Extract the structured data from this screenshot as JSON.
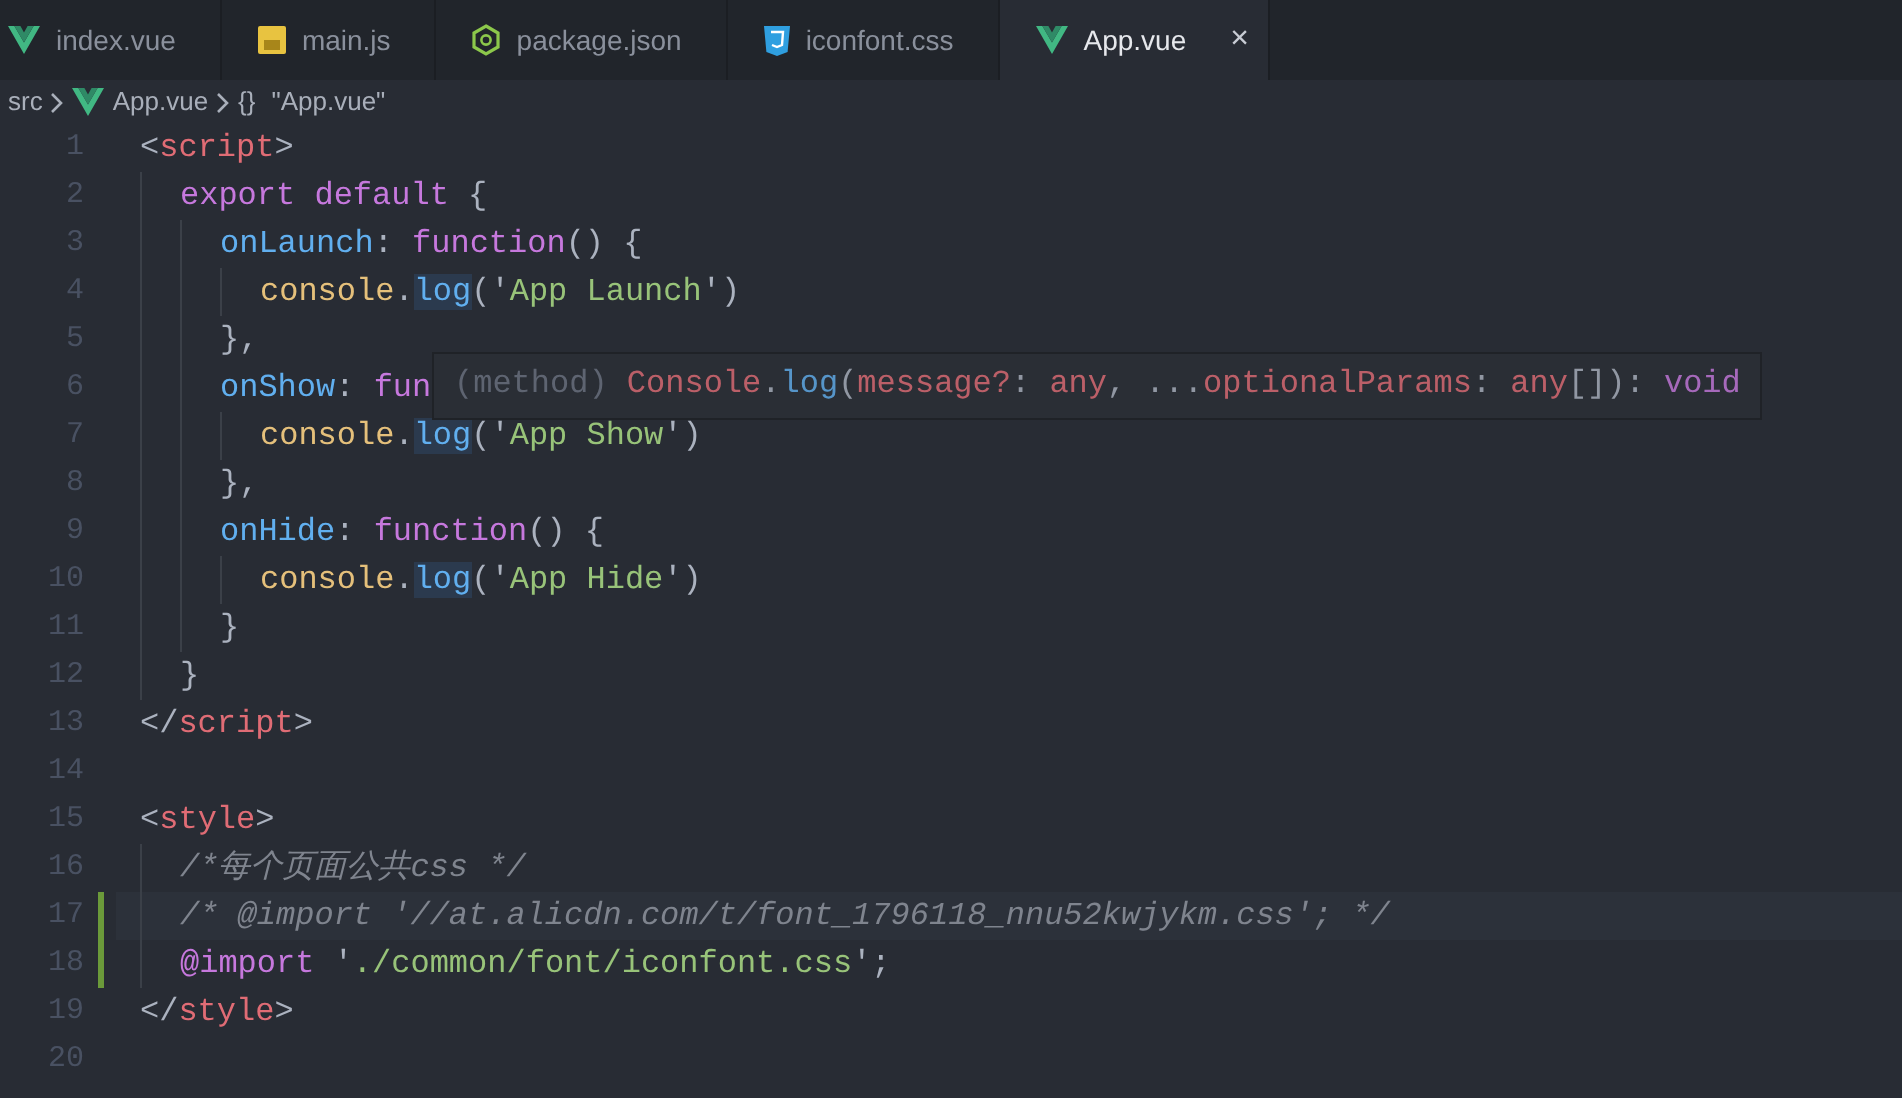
{
  "tabs": [
    {
      "label": "index.vue",
      "kind": "vue",
      "selected": false
    },
    {
      "label": "main.js",
      "kind": "js",
      "selected": false
    },
    {
      "label": "package.json",
      "kind": "node",
      "selected": false
    },
    {
      "label": "iconfont.css",
      "kind": "css",
      "selected": false
    },
    {
      "label": "App.vue",
      "kind": "vue",
      "selected": true,
      "close": "×"
    }
  ],
  "breadcrumb": [
    {
      "kind": "folder",
      "label": "src"
    },
    {
      "kind": "vue",
      "label": "App.vue"
    },
    {
      "kind": "symbol",
      "label": "\"App.vue\"",
      "icon": "{}"
    }
  ],
  "lines": [
    {
      "number": "1",
      "current": false,
      "modified": false,
      "tokens": [
        {
          "kind": "p",
          "t": "<"
        },
        {
          "kind": "tag",
          "t": "script"
        },
        {
          "kind": "p",
          "t": ">"
        }
      ],
      "children": [
        {
          "number": "2",
          "current": false,
          "modified": false,
          "tokens": [
            {
              "kind": "kw",
              "t": "export default"
            },
            {
              "kind": "p",
              "t": " {"
            }
          ],
          "children": [
            {
              "number": "3",
              "current": false,
              "modified": false,
              "tokens": [
                {
                  "kind": "prop",
                  "t": "onLaunch"
                },
                {
                  "kind": "p",
                  "t": ": "
                },
                {
                  "kind": "kw",
                  "t": "function"
                },
                {
                  "kind": "p",
                  "t": "() {"
                }
              ],
              "children": [
                {
                  "number": "4",
                  "current": false,
                  "modified": false,
                  "tokens": [
                    {
                      "kind": "obj",
                      "t": "console"
                    },
                    {
                      "kind": "p",
                      "t": "."
                    },
                    {
                      "kind": "fnhl",
                      "t": "log"
                    },
                    {
                      "kind": "p",
                      "t": "('"
                    },
                    {
                      "kind": "str",
                      "t": "App Launch"
                    },
                    {
                      "kind": "p",
                      "t": "')"
                    }
                  ]
                }
              ]
            },
            {
              "number": "5",
              "current": false,
              "modified": false,
              "tokens": [
                {
                  "kind": "p",
                  "t": "},"
                }
              ]
            },
            {
              "number": "6",
              "current": false,
              "modified": false,
              "tokens": [
                {
                  "kind": "prop",
                  "t": "onShow"
                },
                {
                  "kind": "p",
                  "t": ": "
                },
                {
                  "kind": "kw",
                  "t": "fun"
                }
              ],
              "children": [
                {
                  "number": "7",
                  "current": false,
                  "modified": false,
                  "tokens": [
                    {
                      "kind": "obj",
                      "t": "console"
                    },
                    {
                      "kind": "p",
                      "t": "."
                    },
                    {
                      "kind": "fnhl",
                      "t": "log"
                    },
                    {
                      "kind": "p",
                      "t": "('"
                    },
                    {
                      "kind": "str",
                      "t": "App Show"
                    },
                    {
                      "kind": "p",
                      "t": "')"
                    }
                  ]
                }
              ]
            },
            {
              "number": "8",
              "current": false,
              "modified": false,
              "tokens": [
                {
                  "kind": "p",
                  "t": "},"
                }
              ]
            },
            {
              "number": "9",
              "current": false,
              "modified": false,
              "tokens": [
                {
                  "kind": "prop",
                  "t": "onHide"
                },
                {
                  "kind": "p",
                  "t": ": "
                },
                {
                  "kind": "kw",
                  "t": "function"
                },
                {
                  "kind": "p",
                  "t": "() {"
                }
              ],
              "children": [
                {
                  "number": "10",
                  "current": false,
                  "modified": false,
                  "tokens": [
                    {
                      "kind": "obj",
                      "t": "console"
                    },
                    {
                      "kind": "p",
                      "t": "."
                    },
                    {
                      "kind": "fnhl",
                      "t": "log"
                    },
                    {
                      "kind": "p",
                      "t": "('"
                    },
                    {
                      "kind": "str",
                      "t": "App Hide"
                    },
                    {
                      "kind": "p",
                      "t": "')"
                    }
                  ]
                }
              ]
            },
            {
              "number": "11",
              "current": false,
              "modified": false,
              "tokens": [
                {
                  "kind": "p",
                  "t": "}"
                }
              ]
            }
          ]
        },
        {
          "number": "12",
          "current": false,
          "modified": false,
          "tokens": [
            {
              "kind": "p",
              "t": "}"
            }
          ]
        }
      ]
    },
    {
      "number": "13",
      "current": false,
      "modified": false,
      "tokens": [
        {
          "kind": "p",
          "t": "</"
        },
        {
          "kind": "tag",
          "t": "script"
        },
        {
          "kind": "p",
          "t": ">"
        }
      ]
    },
    {
      "number": "14",
      "current": false,
      "modified": false
    },
    {
      "number": "15",
      "current": false,
      "modified": false,
      "tokens": [
        {
          "kind": "p",
          "t": "<"
        },
        {
          "kind": "tag",
          "t": "style"
        },
        {
          "kind": "p",
          "t": ">"
        }
      ],
      "children": [
        {
          "number": "16",
          "current": false,
          "modified": false,
          "tokens": [
            {
              "kind": "cm",
              "t": "/*每个页面公共css */"
            }
          ]
        },
        {
          "number": "17",
          "current": true,
          "modified": true,
          "tokens": [
            {
              "kind": "cm",
              "t": "/* @import '//at.alicdn.com/t/font_1796118_nnu52kwjykm.css'; */"
            }
          ]
        },
        {
          "number": "18",
          "current": false,
          "modified": true,
          "tokens": [
            {
              "kind": "kw",
              "t": "@import"
            },
            {
              "kind": "p",
              "t": " '"
            },
            {
              "kind": "str",
              "t": "./common/font/iconfont.css"
            },
            {
              "kind": "p",
              "t": "';"
            }
          ]
        }
      ]
    },
    {
      "number": "19",
      "current": false,
      "modified": false,
      "tokens": [
        {
          "kind": "p",
          "t": "</"
        },
        {
          "kind": "tag",
          "t": "style"
        },
        {
          "kind": "p",
          "t": ">"
        }
      ]
    },
    {
      "number": "20",
      "current": false,
      "modified": false
    }
  ],
  "hover": {
    "tokens": [
      {
        "kind": "dim",
        "t": "(method) "
      },
      {
        "kind": "tag",
        "t": "Console"
      },
      {
        "kind": "p",
        "t": "."
      },
      {
        "kind": "prop",
        "t": "log"
      },
      {
        "kind": "p",
        "t": "("
      },
      {
        "kind": "tag",
        "t": "message?"
      },
      {
        "kind": "p",
        "t": ": "
      },
      {
        "kind": "tag",
        "t": "any"
      },
      {
        "kind": "p",
        "t": ", ..."
      },
      {
        "kind": "tag",
        "t": "optionalParams"
      },
      {
        "kind": "p",
        "t": ": "
      },
      {
        "kind": "tag",
        "t": "any"
      },
      {
        "kind": "p",
        "t": "[]): "
      },
      {
        "kind": "kw",
        "t": "void"
      }
    ]
  }
}
